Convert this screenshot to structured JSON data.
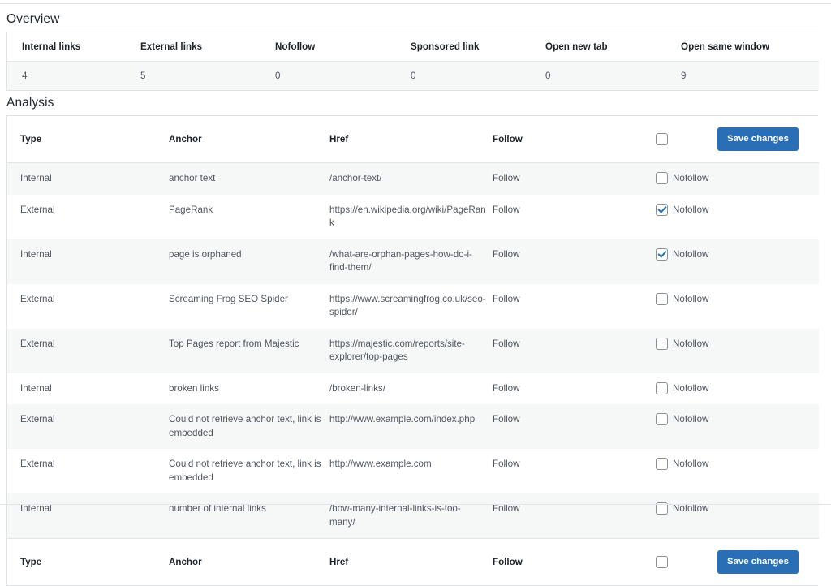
{
  "overview": {
    "title": "Overview",
    "columns": [
      "Internal links",
      "External links",
      "Nofollow",
      "Sponsored link",
      "Open new tab",
      "Open same window"
    ],
    "values": [
      "4",
      "5",
      "0",
      "0",
      "0",
      "9"
    ]
  },
  "analysis": {
    "title": "Analysis",
    "columns": {
      "type": "Type",
      "anchor": "Anchor",
      "href": "Href",
      "follow": "Follow",
      "select_all_checked": false
    },
    "save_label": "Save changes",
    "nofollow_label": "Nofollow",
    "rows": [
      {
        "type": "Internal",
        "anchor": "anchor text",
        "href": "/anchor-text/",
        "follow": "Follow",
        "nofollow_checked": false
      },
      {
        "type": "External",
        "anchor": "PageRank",
        "href": "https://en.wikipedia.org/wiki/PageRank",
        "follow": "Follow",
        "nofollow_checked": true
      },
      {
        "type": "Internal",
        "anchor": "page is orphaned",
        "href": "/what-are-orphan-pages-how-do-i-find-them/",
        "follow": "Follow",
        "nofollow_checked": true
      },
      {
        "type": "External",
        "anchor": "Screaming Frog SEO Spider",
        "href": "https://www.screamingfrog.co.uk/seo-spider/",
        "follow": "Follow",
        "nofollow_checked": false
      },
      {
        "type": "External",
        "anchor": "Top Pages report from Majestic",
        "href": "https://majestic.com/reports/site-explorer/top-pages",
        "follow": "Follow",
        "nofollow_checked": false
      },
      {
        "type": "Internal",
        "anchor": "broken links",
        "href": "/broken-links/",
        "follow": "Follow",
        "nofollow_checked": false
      },
      {
        "type": "External",
        "anchor": "Could not retrieve anchor text, link is embedded",
        "href": "http://www.example.com/index.php",
        "follow": "Follow",
        "nofollow_checked": false
      },
      {
        "type": "External",
        "anchor": "Could not retrieve anchor text, link is embedded",
        "href": "http://www.example.com",
        "follow": "Follow",
        "nofollow_checked": false
      },
      {
        "type": "Internal",
        "anchor": "number of internal links",
        "href": "/how-many-internal-links-is-too-many/",
        "follow": "Follow",
        "nofollow_checked": false
      }
    ]
  },
  "colors": {
    "accent": "#2a6fb5",
    "row_stripe": "#f6f7f7",
    "border": "#e1e2e4",
    "text": "#50575e",
    "heading": "#1d2327"
  }
}
